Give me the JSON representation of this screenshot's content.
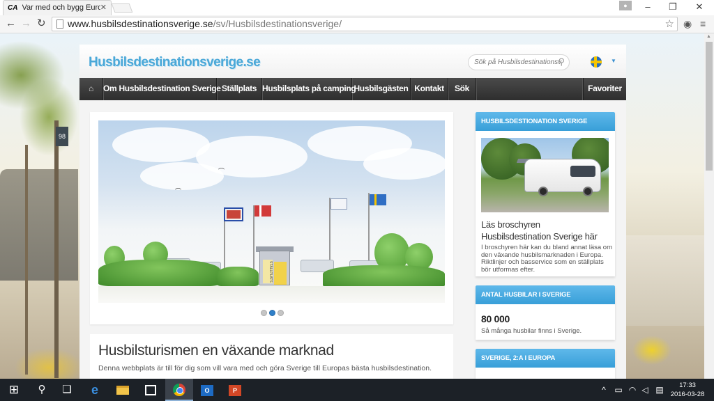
{
  "browser": {
    "tab_title": "Var med och bygg Europas",
    "tab_favicon": "CA",
    "url_host": "www.husbilsdestinationsverige.se",
    "url_path": "/sv/Husbilsdestinationsverige/"
  },
  "site": {
    "logo": "Husbilsdestinationsverige.se",
    "search_placeholder": "Sök på Husbilsdestinationsv",
    "nav": [
      {
        "label": "Om Husbilsdestination Sverige"
      },
      {
        "label": "Ställplats"
      },
      {
        "label": "Husbilsplats på camping"
      },
      {
        "label": "Husbilsgästen"
      },
      {
        "label": "Kontakt"
      },
      {
        "label": "Sök"
      },
      {
        "label": "Favoriter"
      }
    ],
    "slider": {
      "booth_sign": "STÄLLPLATS",
      "active_slide": 2,
      "total_slides": 3
    },
    "article": {
      "title": "Husbilsturismen en växande marknad",
      "text": "Denna webbplats är till för dig som vill vara med och göra Sverige till Europas bästa husbilsdestination."
    },
    "sidebar": {
      "widget1": {
        "heading": "HUSBILSDESTIONATION SVERIGE",
        "link": "Läs broschyren Husbilsdestination Sverige här",
        "desc": "I broschyren här kan du bland annat läsa om den växande husbilsmarknaden i Europa. Riktlinjer och basservice som en ställplats bör utformas efter."
      },
      "widget2": {
        "heading": "ANTAL HUSBILAR I SVERIGE",
        "value": "80 000",
        "desc": "Så många husbilar finns i Sverige."
      },
      "widget3": {
        "heading": "SVERIGE, 2:A I EUROPA"
      }
    }
  },
  "background": {
    "sign_text": "98"
  },
  "taskbar": {
    "time": "17:33",
    "date": "2016-03-28"
  },
  "colors": {
    "accent": "#389fd8",
    "nav_bg": "#2e2e2e",
    "logo": "#4aa8d8"
  }
}
